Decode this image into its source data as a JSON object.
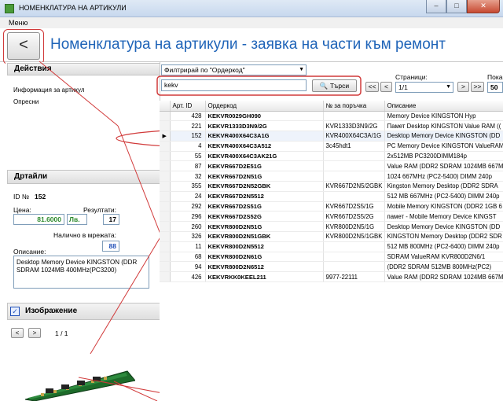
{
  "window": {
    "title": "НОМЕНКЛАТУРА НА АРТИКУЛИ",
    "minimize": "–",
    "maximize": "□",
    "close": "✕"
  },
  "menu": {
    "label": "Меню"
  },
  "header": {
    "back_label": "<",
    "title": "Номенклатура на артикули - заявка на части към ремонт"
  },
  "actions": {
    "title": "Действия",
    "items": [
      "Информация за артикул",
      "Опресни"
    ]
  },
  "details": {
    "title": "Дртайли",
    "id_label": "ID №",
    "id_value": "152",
    "price_label": "Цена:",
    "price_value": "81.6000",
    "currency": "Лв.",
    "results_label": "Резултати:",
    "results_value": "17",
    "stock_label": "Налично в мрежата:",
    "stock_value": "88",
    "description_label": "Описание:",
    "description_value": "Desktop Memory Device KINGSTON (DDR SDRAM 1024MB 400MHz(PC3200)"
  },
  "image_section": {
    "title": "Изображение",
    "checked": "✓",
    "prev": "<",
    "next": ">",
    "page": "1 / 1"
  },
  "filter": {
    "select_value": "Филтрирай по \"Ордеркод\"",
    "search_value": "kekv",
    "search_button": "Търси",
    "pages_label": "Страници:",
    "page_value": "1/1",
    "first": "<<",
    "prev": "<",
    "next": ">",
    "last": ">>",
    "show_label": "Пока",
    "show_value": "50"
  },
  "table": {
    "columns": [
      "Арт. ID",
      "Ордеркод",
      "№ за поръчка",
      "Описание"
    ],
    "rows": [
      [
        "428",
        "KEKVR0029GH090",
        "",
        "Memory Device KINGSTON Hyp"
      ],
      [
        "221",
        "KEKVR1333D3N9/2G",
        "KVR1333D3N9/2G",
        "Памет Desktop KINGSTON Value RAM (("
      ],
      [
        "152",
        "KEKVR400X64C3A1G",
        "KVR400X64C3A/1G",
        "Desktop Memory Device KINGSTON (DD"
      ],
      [
        "4",
        "KEKVR400X64C3A512",
        "3c45hdt1",
        "PC Memory Device KINGSTON ValueRAM"
      ],
      [
        "55",
        "KEKVR400X64C3AK21G",
        "",
        "2x512MB PC3200DIMM184p"
      ],
      [
        "87",
        "KEKVR667D2E51G",
        "",
        "Value RAM (DDR2 SDRAM 1024MB 667M"
      ],
      [
        "32",
        "KEKVR667D2N51G",
        "",
        "1024 667MHz (PC2-5400) DIMM 240p"
      ],
      [
        "355",
        "KEKVR667D2N52GBK",
        "KVR667D2N5/2GBK",
        "Kingston Memory Desktop (DDR2 SDRA"
      ],
      [
        "24",
        "KEKVR667D2N5512",
        "",
        "512 MB 667MHz (PC2-5400) DIMM 240p"
      ],
      [
        "292",
        "KEKVR667D2S51G",
        "KVR667D2S5/1G",
        "Mobile Memory KINGSTON (DDR2 1GB 6"
      ],
      [
        "296",
        "KEKVR667D2S52G",
        "KVR667D2S5/2G",
        "памет - Mobile Memory Device KINGST"
      ],
      [
        "260",
        "KEKVR800D2N51G",
        "KVR800D2N5/1G",
        "Desktop Memory Device KINGSTON (DD"
      ],
      [
        "326",
        "KEKVR800D2N51GBK",
        "KVR800D2N5/1GBK",
        "KINGSTON Memory Desktop (DDR2 SDR"
      ],
      [
        "11",
        "KEKVR800D2N5512",
        "",
        "512 MB 800MHz (PC2-6400) DIMM 240p"
      ],
      [
        "68",
        "KEKVR800D2N61G",
        "",
        "SDRAM ValueRAM KVR800D2N6/1"
      ],
      [
        "94",
        "KEKVR800D2N6512",
        "",
        "(DDR2 SDRAM 512MB 800MHz(PC2)"
      ],
      [
        "426",
        "KEKVRKK0KEEL211",
        "9977-22111",
        "Value RAM (DDR2 SDRAM 1024MB 667M"
      ]
    ],
    "selected_index": 2,
    "selected_marker": "▶"
  }
}
